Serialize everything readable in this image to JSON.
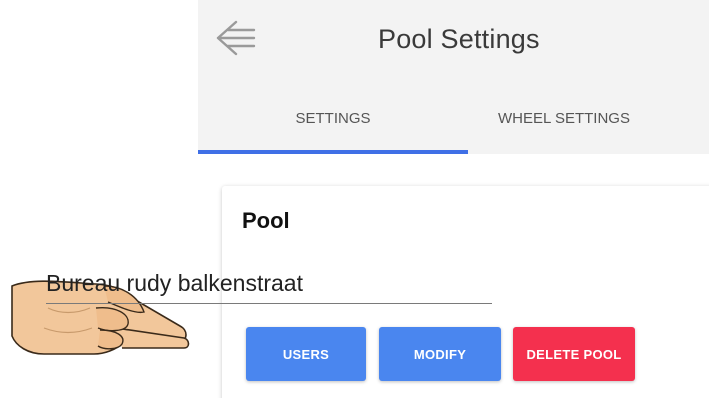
{
  "appbar": {
    "title": "Pool Settings",
    "back_icon": "arrow-left-icon"
  },
  "tabs": [
    {
      "label": "SETTINGS",
      "selected": true
    },
    {
      "label": "WHEEL SETTINGS",
      "selected": false
    }
  ],
  "colors": {
    "tab_indicator": "#3f6fe6",
    "primary_button": "#4a86ef",
    "danger_button": "#f4304e"
  },
  "pool": {
    "heading": "Pool",
    "name_value": "Bureau rudy balkenstraat",
    "buttons": {
      "users": "USERS",
      "modify": "MODIFY",
      "delete": "DELETE POOL"
    }
  },
  "decoration": {
    "hand_icon": "pointing-hand-icon"
  }
}
